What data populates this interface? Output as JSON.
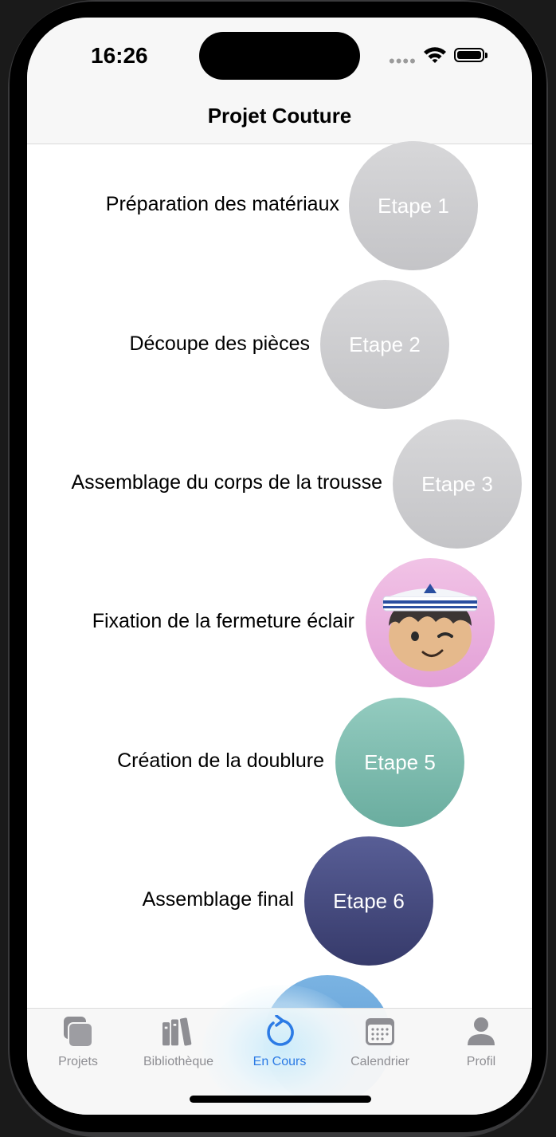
{
  "status": {
    "time": "16:26",
    "dots": "••••"
  },
  "nav": {
    "title": "Projet Couture"
  },
  "steps": [
    {
      "label": "Préparation des matériaux",
      "circle": "Etape 1",
      "color": "#cfcfd1"
    },
    {
      "label": "Découpe des pièces",
      "circle": "Etape 2",
      "color": "#cfcfd1"
    },
    {
      "label": "Assemblage du corps de la trousse",
      "circle": "Etape 3",
      "color": "#cfcfd1"
    },
    {
      "label": "Fixation de la fermeture éclair",
      "circle": "",
      "avatar": "sailor-avatar",
      "color": "#e8a9dc"
    },
    {
      "label": "Création de la doublure",
      "circle": "Etape 5",
      "color": "#7dbcae"
    },
    {
      "label": "Assemblage final",
      "circle": "Etape 6",
      "color": "#454a80"
    },
    {
      "label": "",
      "circle": "",
      "color": "#6aa7db"
    }
  ],
  "tabs": [
    {
      "label": "Projets",
      "icon": "stacked-squares-icon",
      "active": false
    },
    {
      "label": "Bibliothèque",
      "icon": "books-icon",
      "active": false
    },
    {
      "label": "En Cours",
      "icon": "refresh-arrow-icon",
      "active": true
    },
    {
      "label": "Calendrier",
      "icon": "calendar-icon",
      "active": false
    },
    {
      "label": "Profil",
      "icon": "person-icon",
      "active": false
    }
  ],
  "colors": {
    "accent": "#2c7be5",
    "inactive": "#8e8e93"
  }
}
